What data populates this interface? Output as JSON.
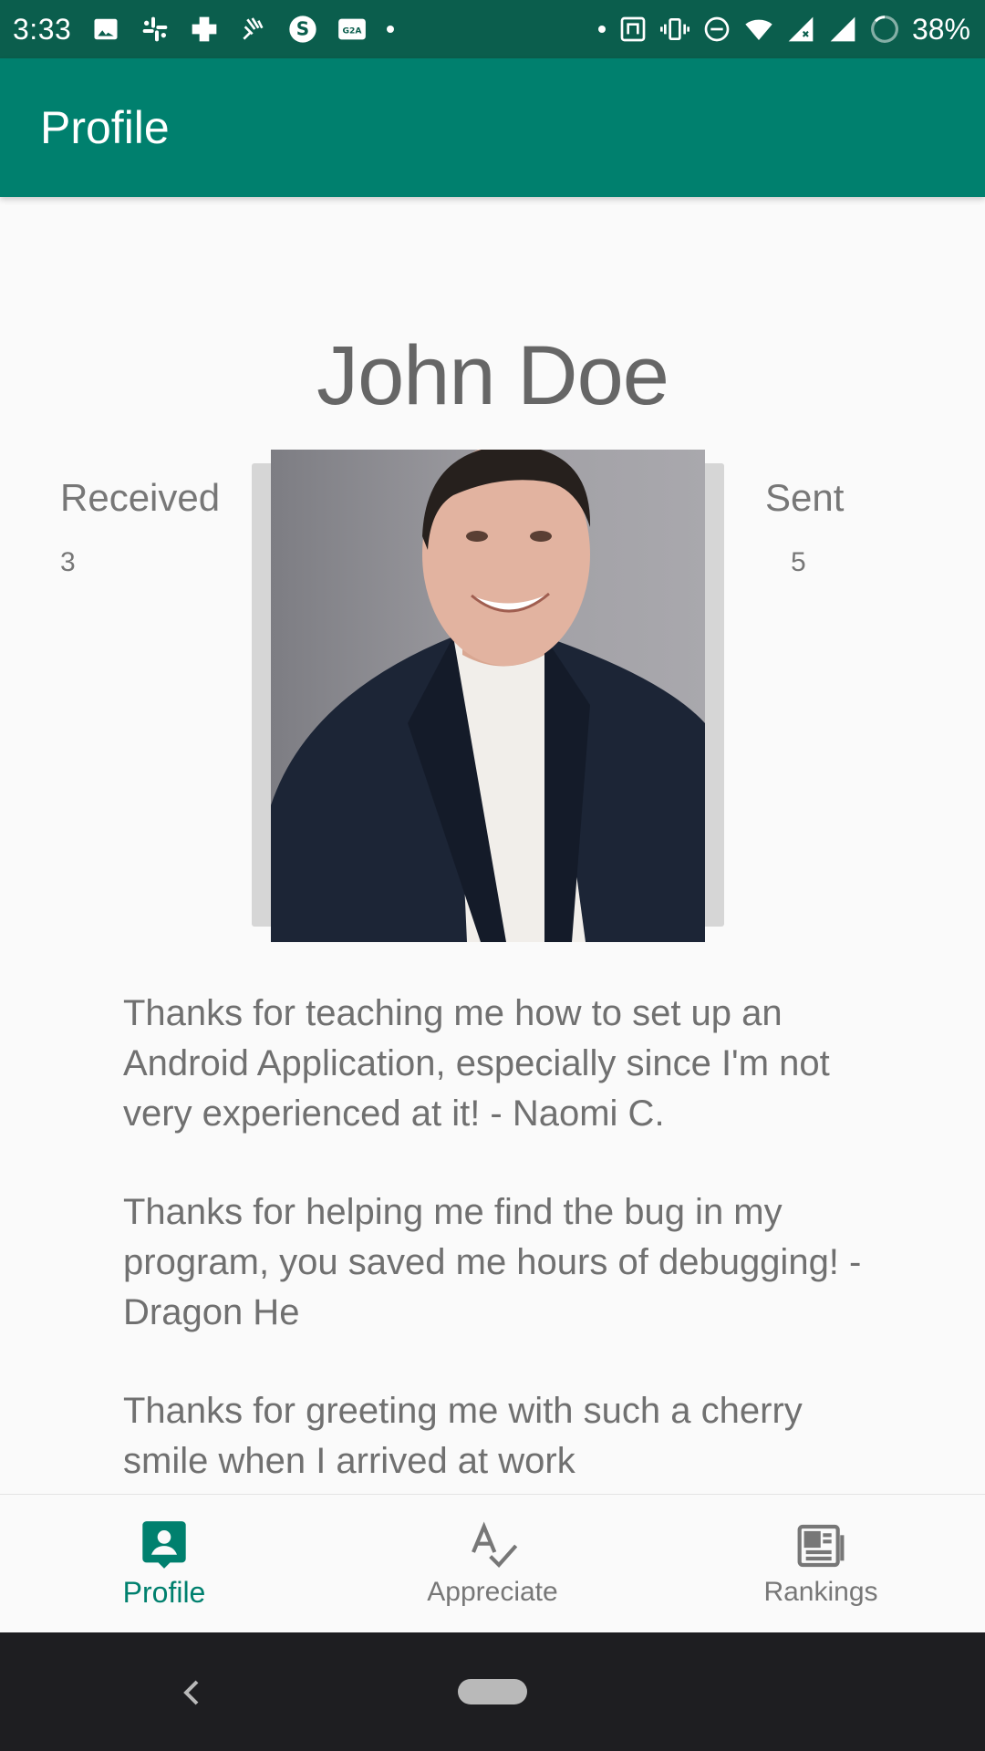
{
  "status_bar": {
    "time": "3:33",
    "battery": "38%",
    "icons_left": [
      "image-icon",
      "slack-icon",
      "plus-app-icon",
      "hand-app-icon",
      "s-app-icon",
      "g2a-icon",
      "dot-icon"
    ],
    "icons_right": [
      "dot-icon",
      "nfc-icon",
      "vibrate-icon",
      "dnd-icon",
      "wifi-icon",
      "signal-icon",
      "signal-icon",
      "battery-icon"
    ],
    "background": "#0b5e4d"
  },
  "appbar": {
    "title": "Profile",
    "color": "#00806e"
  },
  "profile": {
    "name": "John Doe",
    "received_label": "Received",
    "received_value": "3",
    "sent_label": "Sent",
    "sent_value": "5"
  },
  "messages": [
    {
      "text": "Thanks for teaching me how to set up an Android Application, especially since I'm not very experienced at it! - Naomi C."
    },
    {
      "text": "Thanks for helping me find the bug in my program, you saved me hours of debugging! - Dragon He"
    },
    {
      "text": "Thanks for greeting me with such a cherry smile when I arrived at work"
    }
  ],
  "bottom_nav": {
    "items": [
      {
        "label": "Profile",
        "icon": "profile-icon",
        "active": true
      },
      {
        "label": "Appreciate",
        "icon": "spellcheck-icon",
        "active": false
      },
      {
        "label": "Rankings",
        "icon": "newspaper-icon",
        "active": false
      }
    ],
    "active_color": "#00806e"
  },
  "system_nav": {
    "buttons": [
      "back-icon",
      "home-pill"
    ]
  }
}
